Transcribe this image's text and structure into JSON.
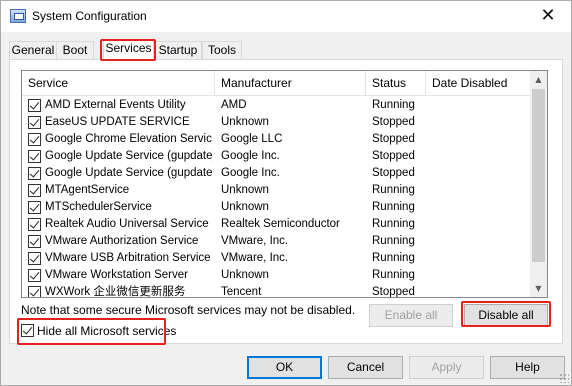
{
  "window": {
    "title": "System Configuration",
    "close_glyph": "✕"
  },
  "tabs": [
    {
      "label": "General"
    },
    {
      "label": "Boot"
    },
    {
      "label": "Services"
    },
    {
      "label": "Startup"
    },
    {
      "label": "Tools"
    }
  ],
  "active_tab": "Services",
  "table": {
    "columns": [
      "Service",
      "Manufacturer",
      "Status",
      "Date Disabled"
    ],
    "rows": [
      {
        "service": "AMD External Events Utility",
        "manufacturer": "AMD",
        "status": "Running",
        "checked": true
      },
      {
        "service": "EaseUS UPDATE SERVICE",
        "manufacturer": "Unknown",
        "status": "Stopped",
        "checked": true
      },
      {
        "service": "Google Chrome Elevation Servic...",
        "manufacturer": "Google LLC",
        "status": "Stopped",
        "checked": true
      },
      {
        "service": "Google Update Service (gupdate)",
        "manufacturer": "Google Inc.",
        "status": "Stopped",
        "checked": true
      },
      {
        "service": "Google Update Service (gupdatem)",
        "manufacturer": "Google Inc.",
        "status": "Stopped",
        "checked": true
      },
      {
        "service": "MTAgentService",
        "manufacturer": "Unknown",
        "status": "Running",
        "checked": true
      },
      {
        "service": "MTSchedulerService",
        "manufacturer": "Unknown",
        "status": "Running",
        "checked": true
      },
      {
        "service": "Realtek Audio Universal Service",
        "manufacturer": "Realtek Semiconductor",
        "status": "Running",
        "checked": true
      },
      {
        "service": "VMware Authorization Service",
        "manufacturer": "VMware, Inc.",
        "status": "Running",
        "checked": true
      },
      {
        "service": "VMware USB Arbitration Service",
        "manufacturer": "VMware, Inc.",
        "status": "Running",
        "checked": true
      },
      {
        "service": "VMware Workstation Server",
        "manufacturer": "Unknown",
        "status": "Running",
        "checked": true
      },
      {
        "service": "WXWork 企业微信更新服务",
        "manufacturer": "Tencent",
        "status": "Stopped",
        "checked": true
      }
    ]
  },
  "scrollbar": {
    "up_glyph": "▲",
    "down_glyph": "▼"
  },
  "note": "Note that some secure Microsoft services may not be disabled.",
  "hide_ms": {
    "label": "Hide all Microsoft services",
    "checked": true
  },
  "buttons": {
    "enable_all": "Enable all",
    "disable_all": "Disable all",
    "ok": "OK",
    "cancel": "Cancel",
    "apply": "Apply",
    "help": "Help"
  },
  "highlight_color": "#e8211f"
}
